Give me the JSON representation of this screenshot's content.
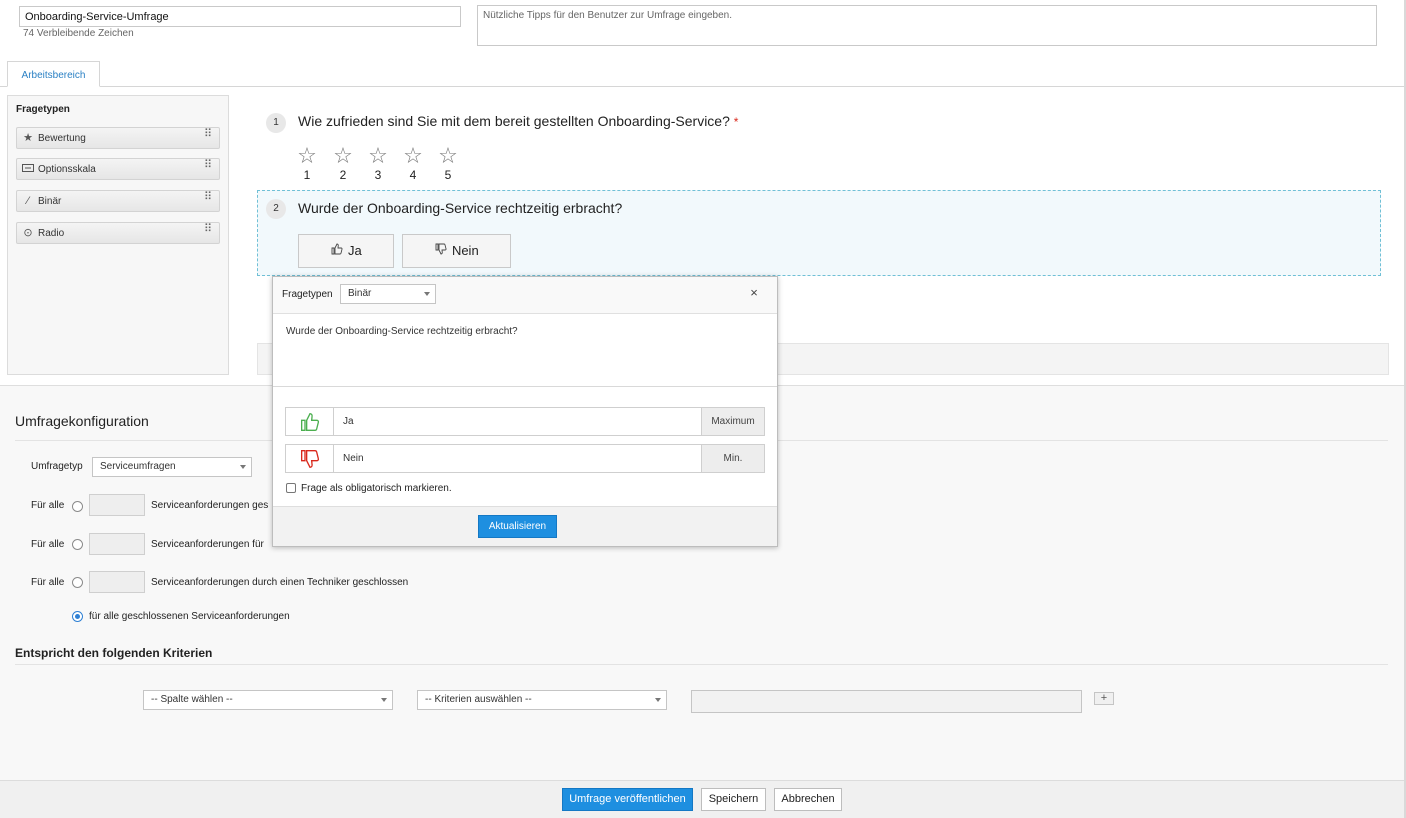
{
  "survey": {
    "title_value": "Onboarding-Service-Umfrage",
    "remaining_chars": "74 Verbleibende Zeichen",
    "tips_placeholder": "Nützliche Tipps für den Benutzer zur Umfrage eingeben."
  },
  "tabs": [
    {
      "label": "Arbeitsbereich"
    }
  ],
  "palette": {
    "title": "Fragetypen",
    "items": [
      {
        "label": "Bewertung",
        "icon": "star-icon"
      },
      {
        "label": "Optionsskala",
        "icon": "scale-icon"
      },
      {
        "label": "Binär",
        "icon": "binary-icon"
      },
      {
        "label": "Radio",
        "icon": "radio-icon"
      }
    ]
  },
  "questions": [
    {
      "num": "1",
      "text": "Wie zufrieden sind Sie mit dem bereit gestellten Onboarding-Service?",
      "required_mark": "*",
      "ratings": [
        "1",
        "2",
        "3",
        "4",
        "5"
      ]
    },
    {
      "num": "2",
      "text": "Wurde der Onboarding-Service rechtzeitig erbracht?",
      "yes_label": "Ja",
      "no_label": "Nein"
    }
  ],
  "popup": {
    "type_label": "Fragetypen",
    "type_value": "Binär",
    "question_text": "Wurde der Onboarding-Service rechtzeitig erbracht?",
    "answers": [
      {
        "text": "Ja",
        "tag": "Maximum",
        "icon": "thumbs-up-icon",
        "color": "#4caf50"
      },
      {
        "text": "Nein",
        "tag": "Min.",
        "icon": "thumbs-down-icon",
        "color": "#d9281c"
      }
    ],
    "mandatory_label": "Frage als obligatorisch markieren.",
    "update_button": "Aktualisieren",
    "close_symbol": "×"
  },
  "config": {
    "title": "Umfragekonfiguration",
    "survey_type_label": "Umfragetyp",
    "survey_type_value": "Serviceumfragen",
    "rows": [
      {
        "prefix": "Für alle",
        "suffix": "Serviceanforderungen ges"
      },
      {
        "prefix": "Für alle",
        "suffix": "Serviceanforderungen für"
      },
      {
        "prefix": "Für alle",
        "suffix": "Serviceanforderungen durch einen Techniker geschlossen"
      }
    ],
    "all_closed_label": "für alle geschlossenen Serviceanforderungen",
    "criteria_title": "Entspricht den folgenden Kriterien",
    "column_select": "-- Spalte wählen --",
    "criteria_select": "-- Kriterien auswählen --",
    "add_symbol": "+"
  },
  "footer": {
    "publish": "Umfrage veröffentlichen",
    "save": "Speichern",
    "cancel": "Abbrechen"
  },
  "colors": {
    "accent": "#1e8fe0",
    "tab_text": "#2a80c4",
    "required": "#d9281c"
  }
}
